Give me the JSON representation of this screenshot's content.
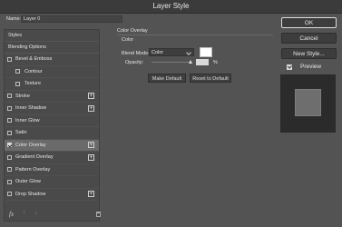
{
  "window": {
    "title": "Layer Style"
  },
  "name_field": {
    "label": "Name:",
    "value": "Layer 0"
  },
  "left_panel": {
    "styles_header": "Styles",
    "blending_options": "Blending Options",
    "items": [
      {
        "label": "Bevel & Emboss",
        "checked": false,
        "plus": false,
        "sub": false,
        "active": false
      },
      {
        "label": "Contour",
        "checked": false,
        "plus": false,
        "sub": true,
        "active": false
      },
      {
        "label": "Texture",
        "checked": false,
        "plus": false,
        "sub": true,
        "active": false
      },
      {
        "label": "Stroke",
        "checked": false,
        "plus": true,
        "sub": false,
        "active": false
      },
      {
        "label": "Inner Shadow",
        "checked": false,
        "plus": true,
        "sub": false,
        "active": false
      },
      {
        "label": "Inner Glow",
        "checked": false,
        "plus": false,
        "sub": false,
        "active": false
      },
      {
        "label": "Satin",
        "checked": false,
        "plus": false,
        "sub": false,
        "active": false
      },
      {
        "label": "Color Overlay",
        "checked": true,
        "plus": true,
        "sub": false,
        "active": true
      },
      {
        "label": "Gradient Overlay",
        "checked": false,
        "plus": true,
        "sub": false,
        "active": false
      },
      {
        "label": "Pattern Overlay",
        "checked": false,
        "plus": false,
        "sub": false,
        "active": false
      },
      {
        "label": "Outer Glow",
        "checked": false,
        "plus": false,
        "sub": false,
        "active": false
      },
      {
        "label": "Drop Shadow",
        "checked": false,
        "plus": true,
        "sub": false,
        "active": false
      }
    ],
    "footer": {
      "fx_label": "fx",
      "up_icon": "arrow-up-icon",
      "down_icon": "arrow-down-icon",
      "trash_icon": "trash-icon"
    }
  },
  "color_overlay": {
    "section_title": "Color Overlay",
    "group_title": "Color",
    "blend_mode_label": "Blend Mode:",
    "blend_mode_value": "Color",
    "opacity_label": "Opacity:",
    "opacity_value": "",
    "opacity_level": 1.0,
    "percent": "%",
    "swatch_color": "#ffffff",
    "make_default": "Make Default",
    "reset_default": "Reset to Default"
  },
  "right_panel": {
    "ok": "OK",
    "cancel": "Cancel",
    "new_style": "New Style...",
    "preview_label": "Preview",
    "preview_checked": true
  },
  "colors": {
    "background": "#535353",
    "panel": "#4a4a4a",
    "active_row": "#6a6a6a",
    "preview_bg": "#2b2b2b"
  }
}
